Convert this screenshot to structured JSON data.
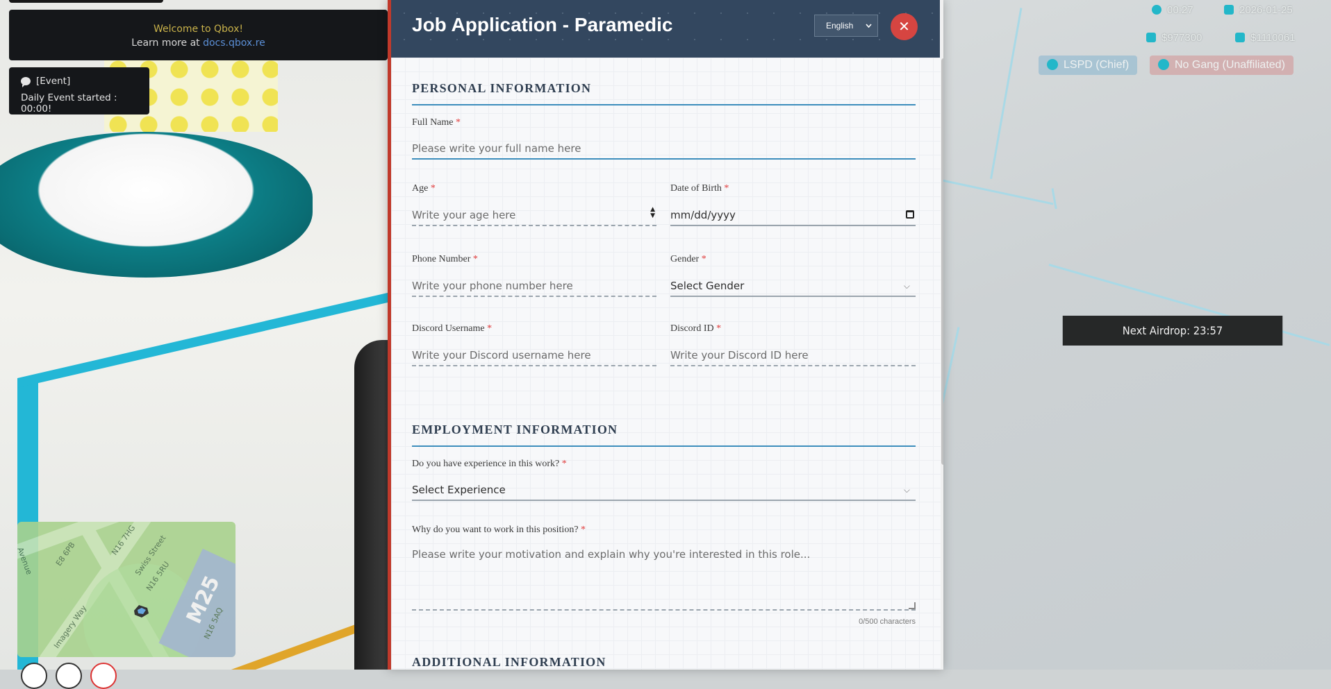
{
  "notifications": {
    "welcome_line1": "Welcome to Qbox!",
    "welcome_line2_prefix": "Learn more at ",
    "welcome_link": "docs.qbox.re",
    "event_title": "[Event]",
    "event_text": "Daily Event started : 00:00!"
  },
  "hud": {
    "time": "00:27",
    "date": "2026-01-25",
    "cash": "$977300",
    "bank": "$1110061",
    "job": "LSPD (Chief)",
    "gang": "No Gang (Unaffiliated)",
    "airdrop": "Next Airdrop: 23:57",
    "accent_color": "#23b7c9"
  },
  "minimap": {
    "highway": "M25",
    "streets": [
      "N16 7HG",
      "Swiss Street",
      "N16 5RU",
      "Avenue",
      "E8 6PB",
      "N16 5AQ",
      "Imagery Way"
    ]
  },
  "form": {
    "title": "Job Application - Paramedic",
    "language": "English",
    "close_label": "✕",
    "sections": {
      "personal": "PERSONAL INFORMATION",
      "employment": "EMPLOYMENT INFORMATION",
      "additional": "ADDITIONAL INFORMATION"
    },
    "fields": {
      "full_name": {
        "label": "Full Name",
        "placeholder": "Please write your full name here"
      },
      "age": {
        "label": "Age",
        "placeholder": "Write your age here"
      },
      "dob": {
        "label": "Date of Birth",
        "placeholder": "mm/dd/yyyy"
      },
      "phone": {
        "label": "Phone Number",
        "placeholder": "Write your phone number here"
      },
      "gender": {
        "label": "Gender",
        "value": "Select Gender"
      },
      "discord_user": {
        "label": "Discord Username",
        "placeholder": "Write your Discord username here"
      },
      "discord_id": {
        "label": "Discord ID",
        "placeholder": "Write your Discord ID here"
      },
      "experience": {
        "label": "Do you have experience in this work?",
        "value": "Select Experience"
      },
      "motivation": {
        "label": "Why do you want to work in this position?",
        "placeholder": "Please write your motivation and explain why you're interested in this role...",
        "counter": "0/500 characters"
      }
    },
    "required_mark": "*",
    "colors": {
      "header": "#33475f",
      "accent": "#3c8dbc",
      "close": "#d64541",
      "required": "#e03b3b"
    }
  }
}
